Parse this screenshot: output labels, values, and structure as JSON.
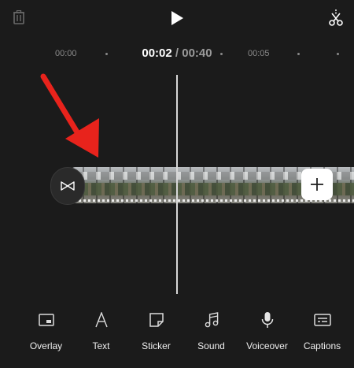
{
  "header": {
    "icons": {
      "delete": "trash-icon",
      "play": "play-icon",
      "split": "split-scissors-icon"
    }
  },
  "timeline": {
    "labels": [
      "00:00",
      "00:05"
    ],
    "current_time": "00:02",
    "separator": " / ",
    "total_time": "00:40"
  },
  "clip": {
    "transition_icon": "bowtie-transition-icon",
    "add_icon": "plus-icon"
  },
  "annotation": {
    "color": "#e8231c"
  },
  "toolbar": {
    "items": [
      {
        "label": "Overlay",
        "icon": "overlay-icon"
      },
      {
        "label": "Text",
        "icon": "text-icon"
      },
      {
        "label": "Sticker",
        "icon": "sticker-icon"
      },
      {
        "label": "Sound",
        "icon": "music-note-icon"
      },
      {
        "label": "Voiceover",
        "icon": "microphone-icon"
      },
      {
        "label": "Captions",
        "icon": "captions-icon"
      }
    ]
  }
}
